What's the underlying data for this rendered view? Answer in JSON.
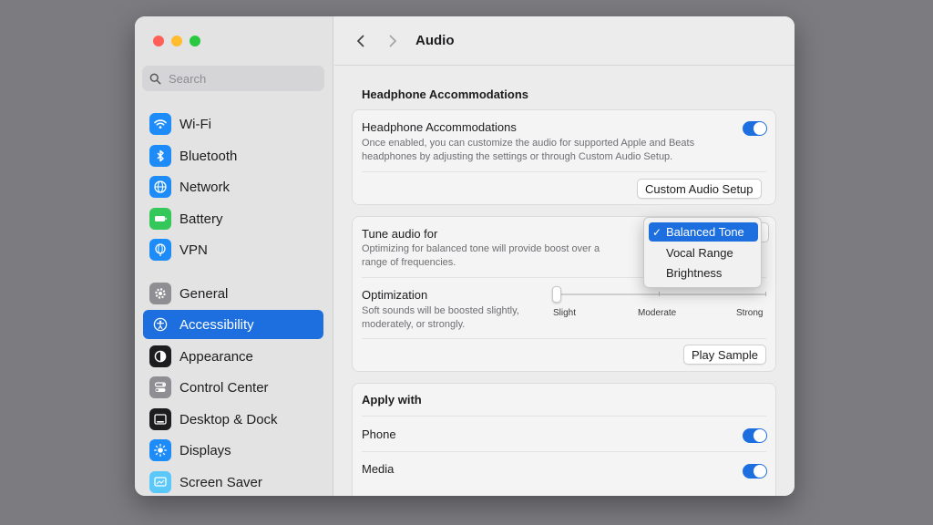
{
  "window": {
    "toolbar": {
      "title": "Audio",
      "back_icon": "chevron-left-icon",
      "forward_icon": "chevron-right-icon"
    },
    "sidebar": {
      "search_placeholder": "Search",
      "items": [
        {
          "label": "Wi-Fi",
          "icon": "wifi-icon",
          "color": "#1d8cf8"
        },
        {
          "label": "Bluetooth",
          "icon": "bluetooth-icon",
          "color": "#1d8cf8"
        },
        {
          "label": "Network",
          "icon": "globe-icon",
          "color": "#1d8cf8"
        },
        {
          "label": "Battery",
          "icon": "battery-icon",
          "color": "#34c759"
        },
        {
          "label": "VPN",
          "icon": "vpn-globe-icon",
          "color": "#1d8cf8"
        },
        {
          "label": "General",
          "icon": "gear-icon",
          "color": "#8e8e93"
        },
        {
          "label": "Accessibility",
          "icon": "accessibility-icon",
          "color": "#1d6fe0",
          "selected": true
        },
        {
          "label": "Appearance",
          "icon": "appearance-icon",
          "color": "#1d1d1f"
        },
        {
          "label": "Control Center",
          "icon": "control-center-icon",
          "color": "#8e8e93"
        },
        {
          "label": "Desktop & Dock",
          "icon": "desktop-dock-icon",
          "color": "#1d1d1f"
        },
        {
          "label": "Displays",
          "icon": "sun-icon",
          "color": "#1d8cf8"
        },
        {
          "label": "Screen Saver",
          "icon": "screen-saver-icon",
          "color": "#5ac8fa"
        }
      ]
    },
    "headphone": {
      "section_title": "Headphone Accommodations",
      "row_title": "Headphone Accommodations",
      "row_desc_1": "Once enabled, you can customize the audio for supported Apple and Beats",
      "row_desc_2": "headphones by adjusting the settings or through Custom Audio Setup.",
      "enabled": true,
      "custom_button": "Custom Audio Setup"
    },
    "tune": {
      "title": "Tune audio for",
      "desc_1": "Optimizing for balanced tone will provide boost over a",
      "desc_2": "range of frequencies.",
      "options": [
        "Balanced Tone",
        "Vocal Range",
        "Brightness"
      ],
      "selected": "Balanced Tone",
      "check": "✓"
    },
    "optimization": {
      "title": "Optimization",
      "desc_1": "Soft sounds will be boosted slightly,",
      "desc_2": "moderately, or strongly.",
      "labels": [
        "Slight",
        "Moderate",
        "Strong"
      ],
      "value_index": 0,
      "play_button": "Play Sample"
    },
    "apply": {
      "section_title": "Apply with",
      "phone_label": "Phone",
      "phone_on": true,
      "media_label": "Media",
      "media_on": true
    },
    "accent_color": "#1d6fe0"
  }
}
